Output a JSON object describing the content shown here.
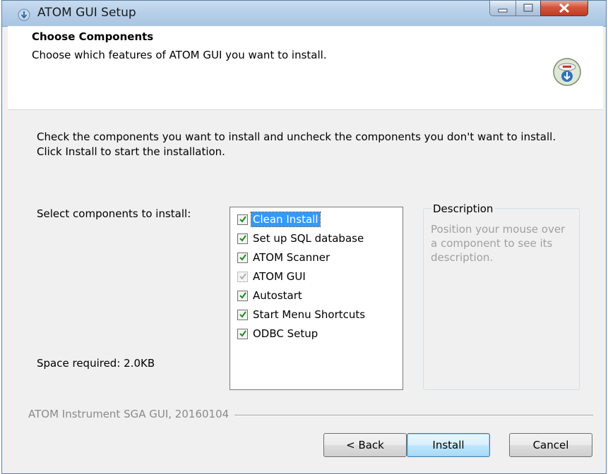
{
  "window": {
    "title": "ATOM GUI Setup"
  },
  "header": {
    "title": "Choose Components",
    "subtitle": "Choose which features of ATOM GUI you want to install."
  },
  "body": {
    "instructions": "Check the components you want to install and uncheck the components you don't want to install. Click Install to start the installation.",
    "select_label": "Select components to install:",
    "space_required": "Space required: 2.0KB"
  },
  "components": [
    {
      "label": "Clean Install",
      "checked": true,
      "selected": true,
      "disabled": false
    },
    {
      "label": "Set up SQL database",
      "checked": true,
      "selected": false,
      "disabled": false
    },
    {
      "label": "ATOM Scanner",
      "checked": true,
      "selected": false,
      "disabled": false
    },
    {
      "label": "ATOM GUI",
      "checked": true,
      "selected": false,
      "disabled": true
    },
    {
      "label": "Autostart",
      "checked": true,
      "selected": false,
      "disabled": false
    },
    {
      "label": "Start Menu Shortcuts",
      "checked": true,
      "selected": false,
      "disabled": false
    },
    {
      "label": "ODBC Setup",
      "checked": true,
      "selected": false,
      "disabled": false
    }
  ],
  "description": {
    "title": "Description",
    "text": "Position your mouse over a component to see its description."
  },
  "footer": {
    "branding": "ATOM Instrument SGA GUI, 20160104"
  },
  "buttons": {
    "back": "< Back",
    "install": "Install",
    "cancel": "Cancel"
  },
  "colors": {
    "selection": "#3399ff",
    "checkmark": "#1f8a1f",
    "disabled_check": "#b0b0b0"
  }
}
